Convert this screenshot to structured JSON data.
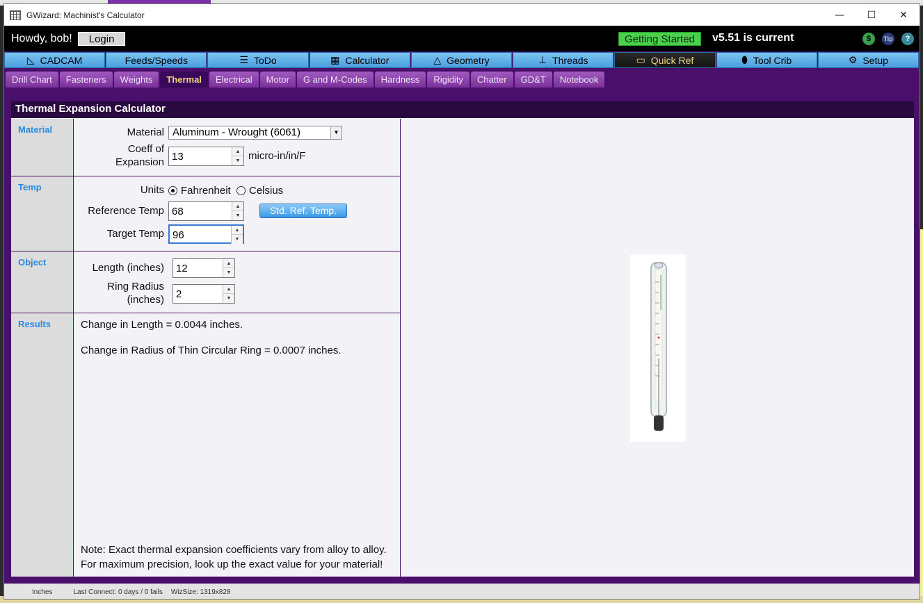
{
  "window": {
    "title": "GWizard: Machinist's Calculator",
    "controls": [
      "—",
      "☐",
      "✕"
    ]
  },
  "header": {
    "greeting": "Howdy, bob!",
    "login_label": "Login",
    "getting_started_label": "Getting Started",
    "version_text": "v5.51 is current",
    "icons": [
      "cart-icon",
      "tip-icon",
      "help-icon"
    ],
    "tip_label": "Tip",
    "help_label": "?",
    "cart_label": "$"
  },
  "main_tabs": [
    {
      "label": "CADCAM",
      "icon": "cadcam-icon"
    },
    {
      "label": "Feeds/Speeds",
      "icon": ""
    },
    {
      "label": "ToDo",
      "icon": "todo-icon"
    },
    {
      "label": "Calculator",
      "icon": "calculator-icon"
    },
    {
      "label": "Geometry",
      "icon": "geometry-icon"
    },
    {
      "label": "Threads",
      "icon": "screw-icon"
    },
    {
      "label": "Quick Ref",
      "icon": "book-icon"
    },
    {
      "label": "Tool Crib",
      "icon": "tool-icon"
    },
    {
      "label": "Setup",
      "icon": "gear-icon"
    }
  ],
  "sub_tabs": [
    "Drill Chart",
    "Fasteners",
    "Weights",
    "Thermal",
    "Electrical",
    "Motor",
    "G and M-Codes",
    "Hardness",
    "Rigidity",
    "Chatter",
    "GD&T",
    "Notebook"
  ],
  "panel": {
    "title": "Thermal Expansion Calculator",
    "material": {
      "section_label": "Material",
      "material_label": "Material",
      "material_value": "Aluminum - Wrought (6061)",
      "coeff_label_1": "Coeff of",
      "coeff_label_2": "Expansion",
      "coeff_value": "13",
      "coeff_unit": "micro-in/in/F"
    },
    "temp": {
      "section_label": "Temp",
      "units_label": "Units",
      "fahrenheit_label": "Fahrenheit",
      "celsius_label": "Celsius",
      "selected_unit": "Fahrenheit",
      "ref_label": "Reference Temp",
      "ref_value": "68",
      "std_button_label": "Std. Ref. Temp.",
      "target_label": "Target Temp",
      "target_value": "96"
    },
    "object": {
      "section_label": "Object",
      "length_label": "Length (inches)",
      "length_value": "12",
      "radius_label_1": "Ring Radius",
      "radius_label_2": "(inches)",
      "radius_value": "2"
    },
    "results": {
      "section_label": "Results",
      "line1": "Change in Length = 0.0044 inches.",
      "line2": "Change in Radius of Thin Circular Ring = 0.0007 inches.",
      "note1": "Note: Exact thermal expansion coefficients vary from alloy to alloy.",
      "note2": "For maximum precision, look up the exact value for your material!"
    }
  },
  "status": {
    "units": "Inches",
    "connect": "Last Connect: 0 days / 0 fails",
    "size": "WizSize: 1319x828"
  }
}
